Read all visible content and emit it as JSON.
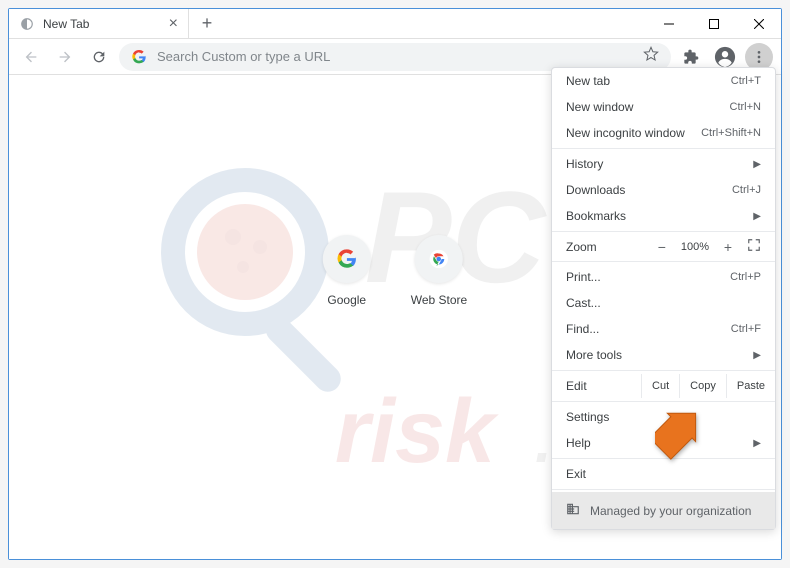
{
  "tab": {
    "title": "New Tab"
  },
  "omnibox": {
    "placeholder": "Search Custom or type a URL"
  },
  "shortcuts": [
    {
      "label": "Google"
    },
    {
      "label": "Web Store"
    }
  ],
  "menu": {
    "new_tab": {
      "label": "New tab",
      "shortcut": "Ctrl+T"
    },
    "new_window": {
      "label": "New window",
      "shortcut": "Ctrl+N"
    },
    "new_incognito": {
      "label": "New incognito window",
      "shortcut": "Ctrl+Shift+N"
    },
    "history": {
      "label": "History"
    },
    "downloads": {
      "label": "Downloads",
      "shortcut": "Ctrl+J"
    },
    "bookmarks": {
      "label": "Bookmarks"
    },
    "zoom": {
      "label": "Zoom",
      "value": "100%"
    },
    "print": {
      "label": "Print...",
      "shortcut": "Ctrl+P"
    },
    "cast": {
      "label": "Cast..."
    },
    "find": {
      "label": "Find...",
      "shortcut": "Ctrl+F"
    },
    "more_tools": {
      "label": "More tools"
    },
    "edit": {
      "label": "Edit",
      "cut": "Cut",
      "copy": "Copy",
      "paste": "Paste"
    },
    "settings": {
      "label": "Settings"
    },
    "help": {
      "label": "Help"
    },
    "exit": {
      "label": "Exit"
    },
    "managed": {
      "label": "Managed by your organization"
    }
  },
  "watermark": {
    "text_top": "PC",
    "text_bottom": "risk.com"
  }
}
